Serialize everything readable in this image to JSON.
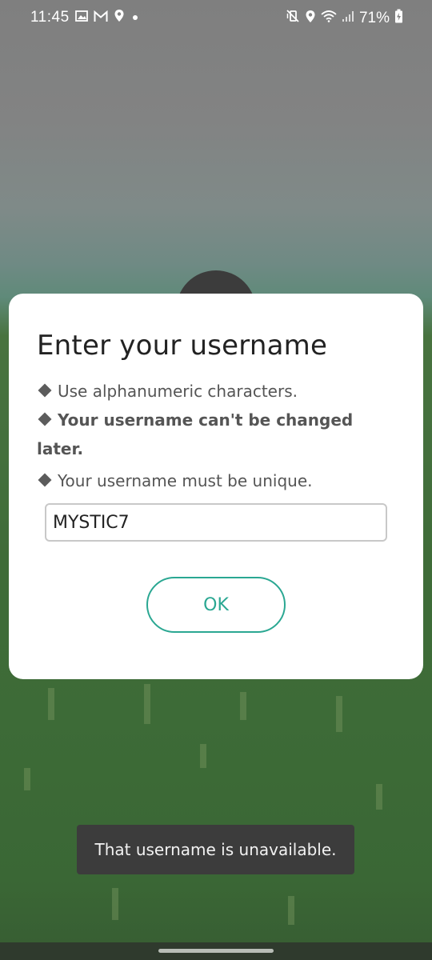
{
  "status_bar": {
    "time": "11:45",
    "battery_percent": "71%",
    "left_icons": [
      "gallery-icon",
      "gmail-icon",
      "location-pin-icon",
      "dot-icon"
    ],
    "right_icons": [
      "mute-vibrate-icon",
      "location-icon",
      "wifi-icon",
      "signal-icon",
      "battery-charging-icon"
    ]
  },
  "dialog": {
    "title": "Enter your username",
    "rules": [
      "Use alphanumeric characters.",
      "Your username can't be changed later.",
      "Your username must be unique."
    ],
    "username_value": "MYSTIC7",
    "ok_label": "OK"
  },
  "toast": {
    "message": "That username is unavailable."
  },
  "colors": {
    "accent": "#2aa792",
    "dialog_background": "#ffffff",
    "toast_background": "#3c3c3c"
  }
}
